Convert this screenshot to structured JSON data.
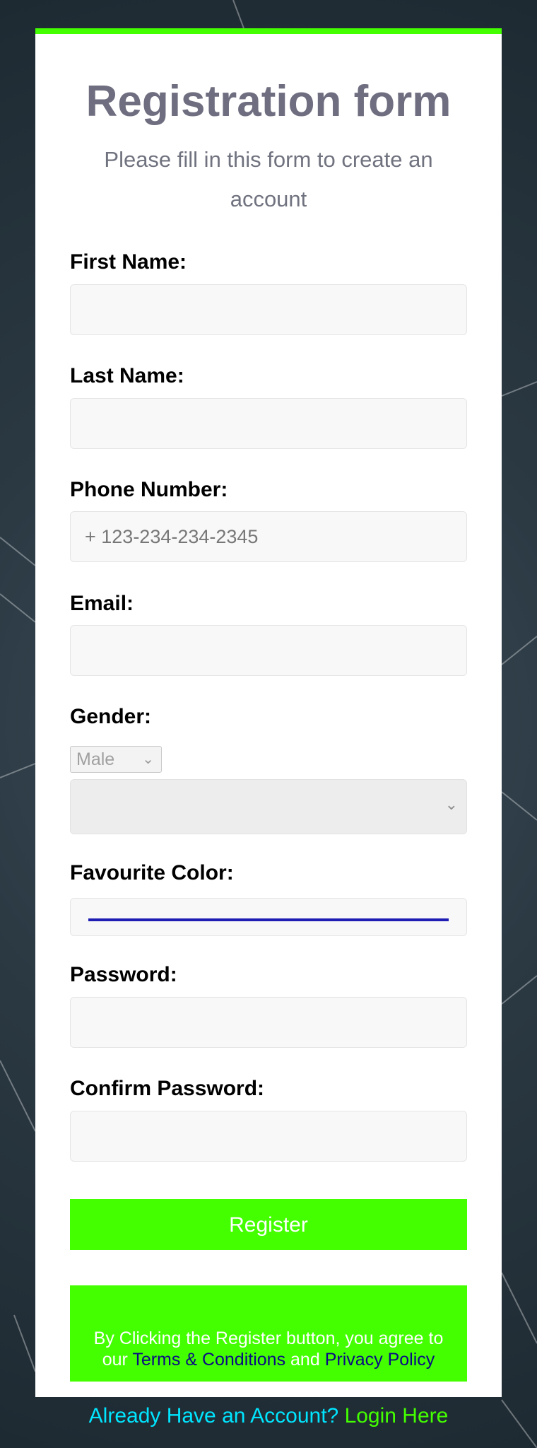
{
  "form": {
    "title": "Registration form",
    "subtitle": "Please fill in this form to create an account",
    "fields": {
      "first_name_label": "First Name:",
      "last_name_label": "Last Name:",
      "phone_label": "Phone Number:",
      "phone_placeholder": "+ 123-234-234-2345",
      "email_label": "Email:",
      "gender_label": "Gender:",
      "gender_selected": "Male",
      "favourite_color_label": "Favourite Color:",
      "password_label": "Password:",
      "confirm_password_label": "Confirm Password:"
    },
    "register_label": "Register",
    "terms": {
      "prefix": "By Clicking the Register button, you agree to our",
      "terms_link": "Terms & Conditions",
      "and": "and",
      "privacy_link": "Privacy Policy"
    },
    "login": {
      "prompt": "Already Have an Account?",
      "link": "Login Here"
    }
  },
  "colors": {
    "accent": "#43ff00",
    "title": "#6e6e80",
    "favourite_color_value": "#1e1eb4",
    "link_cyan": "#00e5ff",
    "link_dark_blue": "#0b0b84"
  },
  "icons": {
    "select_arrow": "chevron-down-icon"
  }
}
